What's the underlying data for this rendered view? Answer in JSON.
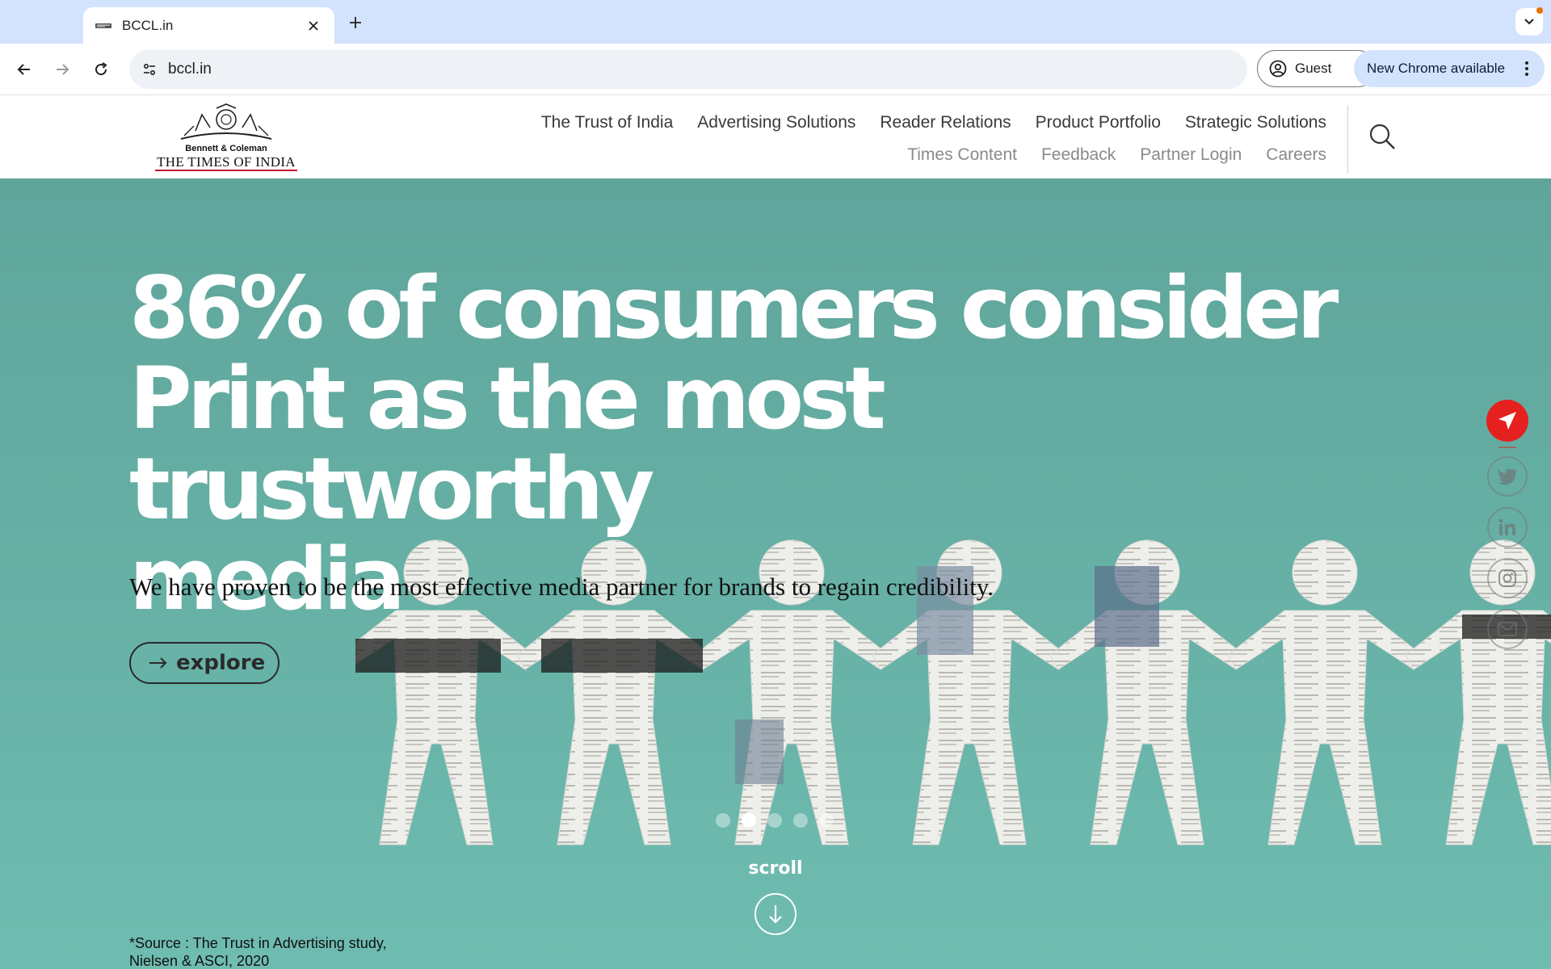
{
  "browser": {
    "tab_title": "BCCL.in",
    "url": "bccl.in",
    "profile_label": "Guest",
    "update_label": "New Chrome available"
  },
  "site": {
    "logo_line1": "Bennett & Coleman",
    "logo_line2": "THE TIMES OF INDIA",
    "nav_primary": [
      "The Trust of India",
      "Advertising Solutions",
      "Reader Relations",
      "Product Portfolio",
      "Strategic Solutions"
    ],
    "nav_secondary": [
      "Times Content",
      "Feedback",
      "Partner Login",
      "Careers"
    ]
  },
  "hero": {
    "headline_lines": [
      "86% of consumers consider",
      "Print as the most trustworthy",
      "media"
    ],
    "subheadline": "We have proven to be the most effective media partner for brands to regain credibility.",
    "cta_label": "explore",
    "slide_count": 5,
    "active_slide": 2,
    "scroll_label": "scroll",
    "source_lines": [
      "*Source : The Trust in Advertising study,",
      "Nielsen & ASCI, 2020"
    ]
  },
  "social": [
    "share-icon",
    "twitter-icon",
    "linkedin-icon",
    "instagram-icon",
    "mail-icon"
  ],
  "colors": {
    "hero_bg": "#67b1a6",
    "share_red": "#e4211f",
    "tab_strip": "#d3e3fd"
  }
}
